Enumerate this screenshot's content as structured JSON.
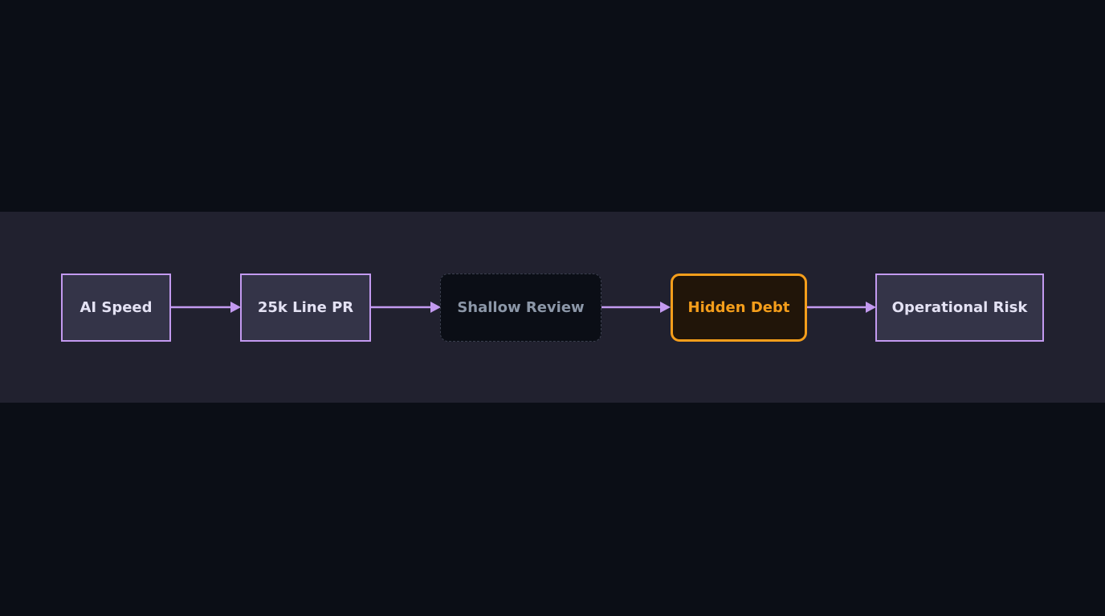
{
  "diagram": {
    "nodes": [
      {
        "id": "ai-speed",
        "label": "AI Speed",
        "style": "standard"
      },
      {
        "id": "25k-line-pr",
        "label": "25k Line PR",
        "style": "standard"
      },
      {
        "id": "shallow-review",
        "label": "Shallow Review",
        "style": "dashed-muted"
      },
      {
        "id": "hidden-debt",
        "label": "Hidden Debt",
        "style": "highlight"
      },
      {
        "id": "operational-risk",
        "label": "Operational Risk",
        "style": "standard"
      }
    ],
    "edges": [
      {
        "from": "ai-speed",
        "to": "25k-line-pr"
      },
      {
        "from": "25k-line-pr",
        "to": "shallow-review"
      },
      {
        "from": "shallow-review",
        "to": "hidden-debt"
      },
      {
        "from": "hidden-debt",
        "to": "operational-risk"
      }
    ]
  },
  "colors": {
    "background": "#0b0e16",
    "band": "#21212f",
    "node_fill": "#343448",
    "node_border": "#c39af0",
    "node_text": "#e4e2f4",
    "edge": "#c39af0",
    "muted_text": "#8c97a8",
    "highlight": "#f59e1b",
    "highlight_fill": "#211509"
  }
}
